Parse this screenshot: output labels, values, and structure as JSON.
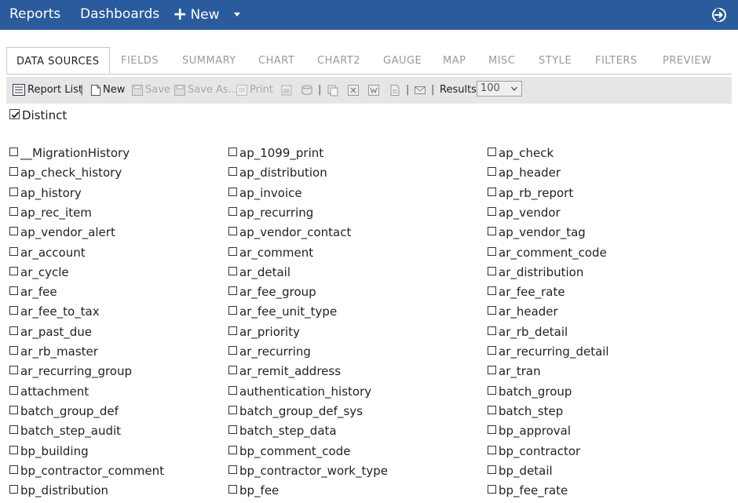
{
  "navbar": {
    "reports": "Reports",
    "dashboards": "Dashboards",
    "new": "New",
    "plus_icon": "+"
  },
  "tabs": [
    {
      "label": "DATA SOURCES",
      "active": true
    },
    {
      "label": "FIELDS"
    },
    {
      "label": "SUMMARY"
    },
    {
      "label": "CHART"
    },
    {
      "label": "CHART2"
    },
    {
      "label": "GAUGE"
    },
    {
      "label": "MAP"
    },
    {
      "label": "MISC"
    },
    {
      "label": "STYLE"
    },
    {
      "label": "FILTERS"
    },
    {
      "label": "PREVIEW"
    }
  ],
  "toolbar": {
    "report_list": "Report List",
    "new": "New",
    "save": "Save",
    "save_as": "Save As...",
    "print": "Print",
    "separator": "|",
    "results_label": "Results",
    "results_value": "100"
  },
  "distinct": {
    "label": "Distinct",
    "checked": true
  },
  "tables": [
    [
      "__MigrationHistory",
      "ap_1099_print",
      "ap_check"
    ],
    [
      "ap_check_history",
      "ap_distribution",
      "ap_header"
    ],
    [
      "ap_history",
      "ap_invoice",
      "ap_rb_report"
    ],
    [
      "ap_rec_item",
      "ap_recurring",
      "ap_vendor"
    ],
    [
      "ap_vendor_alert",
      "ap_vendor_contact",
      "ap_vendor_tag"
    ],
    [
      "ar_account",
      "ar_comment",
      "ar_comment_code"
    ],
    [
      "ar_cycle",
      "ar_detail",
      "ar_distribution"
    ],
    [
      "ar_fee",
      "ar_fee_group",
      "ar_fee_rate"
    ],
    [
      "ar_fee_to_tax",
      "ar_fee_unit_type",
      "ar_header"
    ],
    [
      "ar_past_due",
      "ar_priority",
      "ar_rb_detail"
    ],
    [
      "ar_rb_master",
      "ar_recurring",
      "ar_recurring_detail"
    ],
    [
      "ar_recurring_group",
      "ar_remit_address",
      "ar_tran"
    ],
    [
      "attachment",
      "authentication_history",
      "batch_group"
    ],
    [
      "batch_group_def",
      "batch_group_def_sys",
      "batch_step"
    ],
    [
      "batch_step_audit",
      "batch_step_data",
      "bp_approval"
    ],
    [
      "bp_building",
      "bp_comment_code",
      "bp_contractor"
    ],
    [
      "bp_contractor_comment",
      "bp_contractor_work_type",
      "bp_detail"
    ],
    [
      "bp_distribution",
      "bp_fee",
      "bp_fee_rate"
    ]
  ],
  "colors": {
    "navbar": "#2a5b9c",
    "toolbar": "#e6e6e6",
    "tab_inactive": "#9a9a9a"
  }
}
